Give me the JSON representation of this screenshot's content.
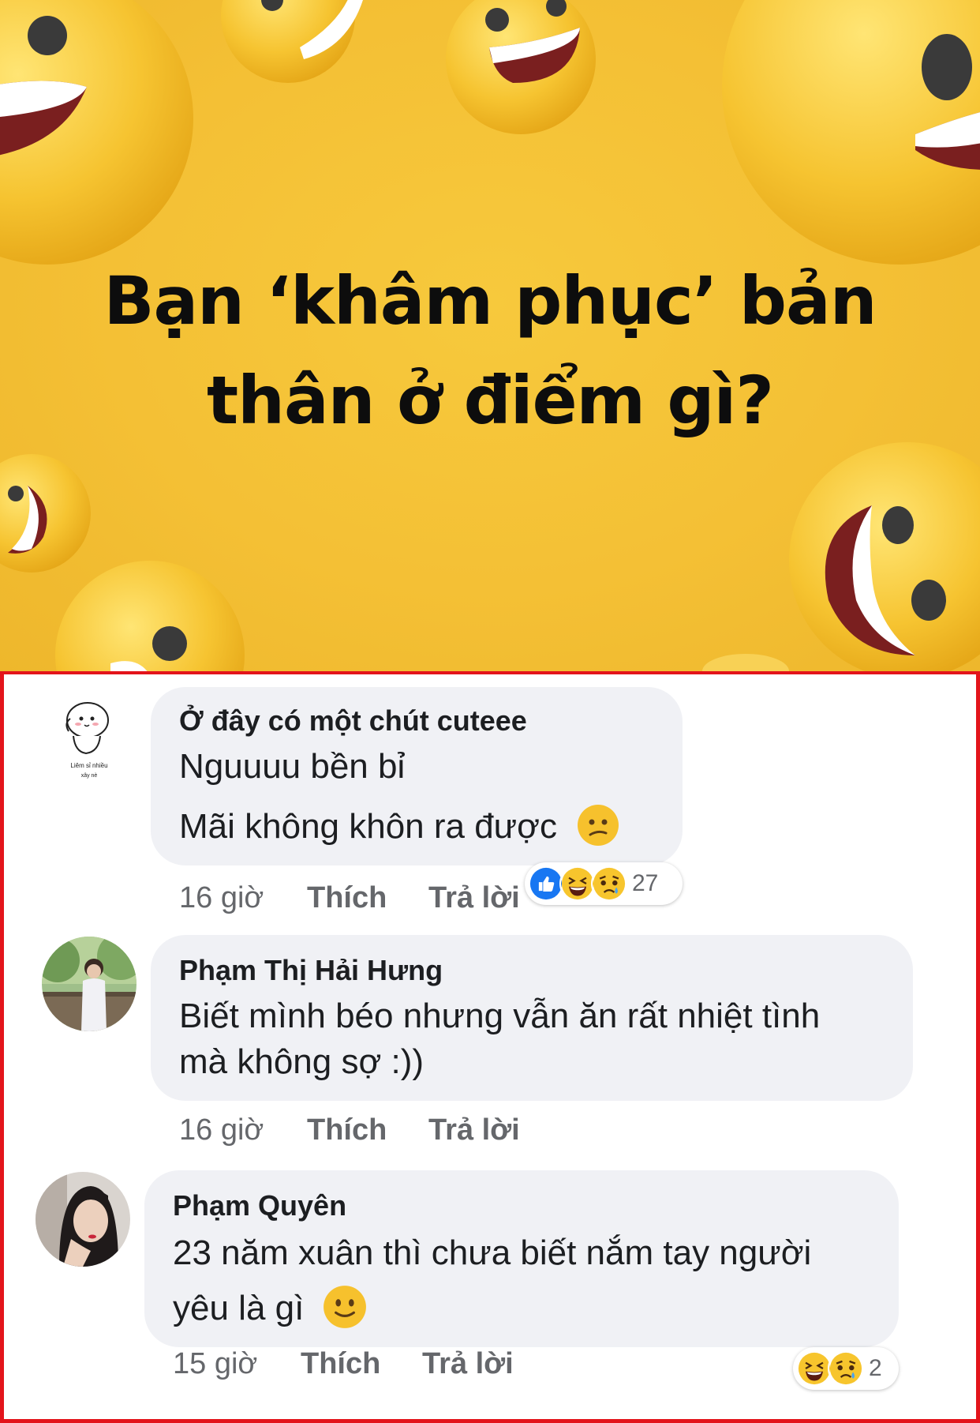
{
  "hero": {
    "title_line1": "Bạn ‘khâm phục’ bản",
    "title_line2": "thân ở điểm gì?"
  },
  "colors": {
    "hero_bg": "#f4c035",
    "highlight_border": "#e3141b",
    "bubble_bg": "#f0f1f5",
    "meta_text": "#65676b",
    "like_blue": "#1877f2"
  },
  "comments": [
    {
      "author": "Ở đây có một chút cuteee",
      "avatar_caption_line1": "Liêm sỉ nhiều",
      "avatar_caption_line2": "xây nè",
      "lines": [
        "Nguuuu bền bỉ",
        "Mãi không khôn ra được"
      ],
      "line_emoji": "confused-face",
      "time": "16 giờ",
      "like_label": "Thích",
      "reply_label": "Trả lời",
      "reactions": [
        "like",
        "haha",
        "sad"
      ],
      "reaction_count": "27"
    },
    {
      "author": "Phạm Thị Hải Hưng",
      "lines": [
        "Biết mình béo nhưng vẫn ăn rất nhiệt tình",
        "mà không sợ :))"
      ],
      "time": "16 giờ",
      "like_label": "Thích",
      "reply_label": "Trả lời"
    },
    {
      "author": "Phạm Quyên",
      "lines": [
        "23 năm xuân thì chưa biết nắm tay người",
        "yêu là gì"
      ],
      "line_emoji": "slightly-smiling-face",
      "time": "15 giờ",
      "like_label": "Thích",
      "reply_label": "Trả lời",
      "reactions": [
        "haha",
        "sad"
      ],
      "reaction_count": "2"
    }
  ]
}
